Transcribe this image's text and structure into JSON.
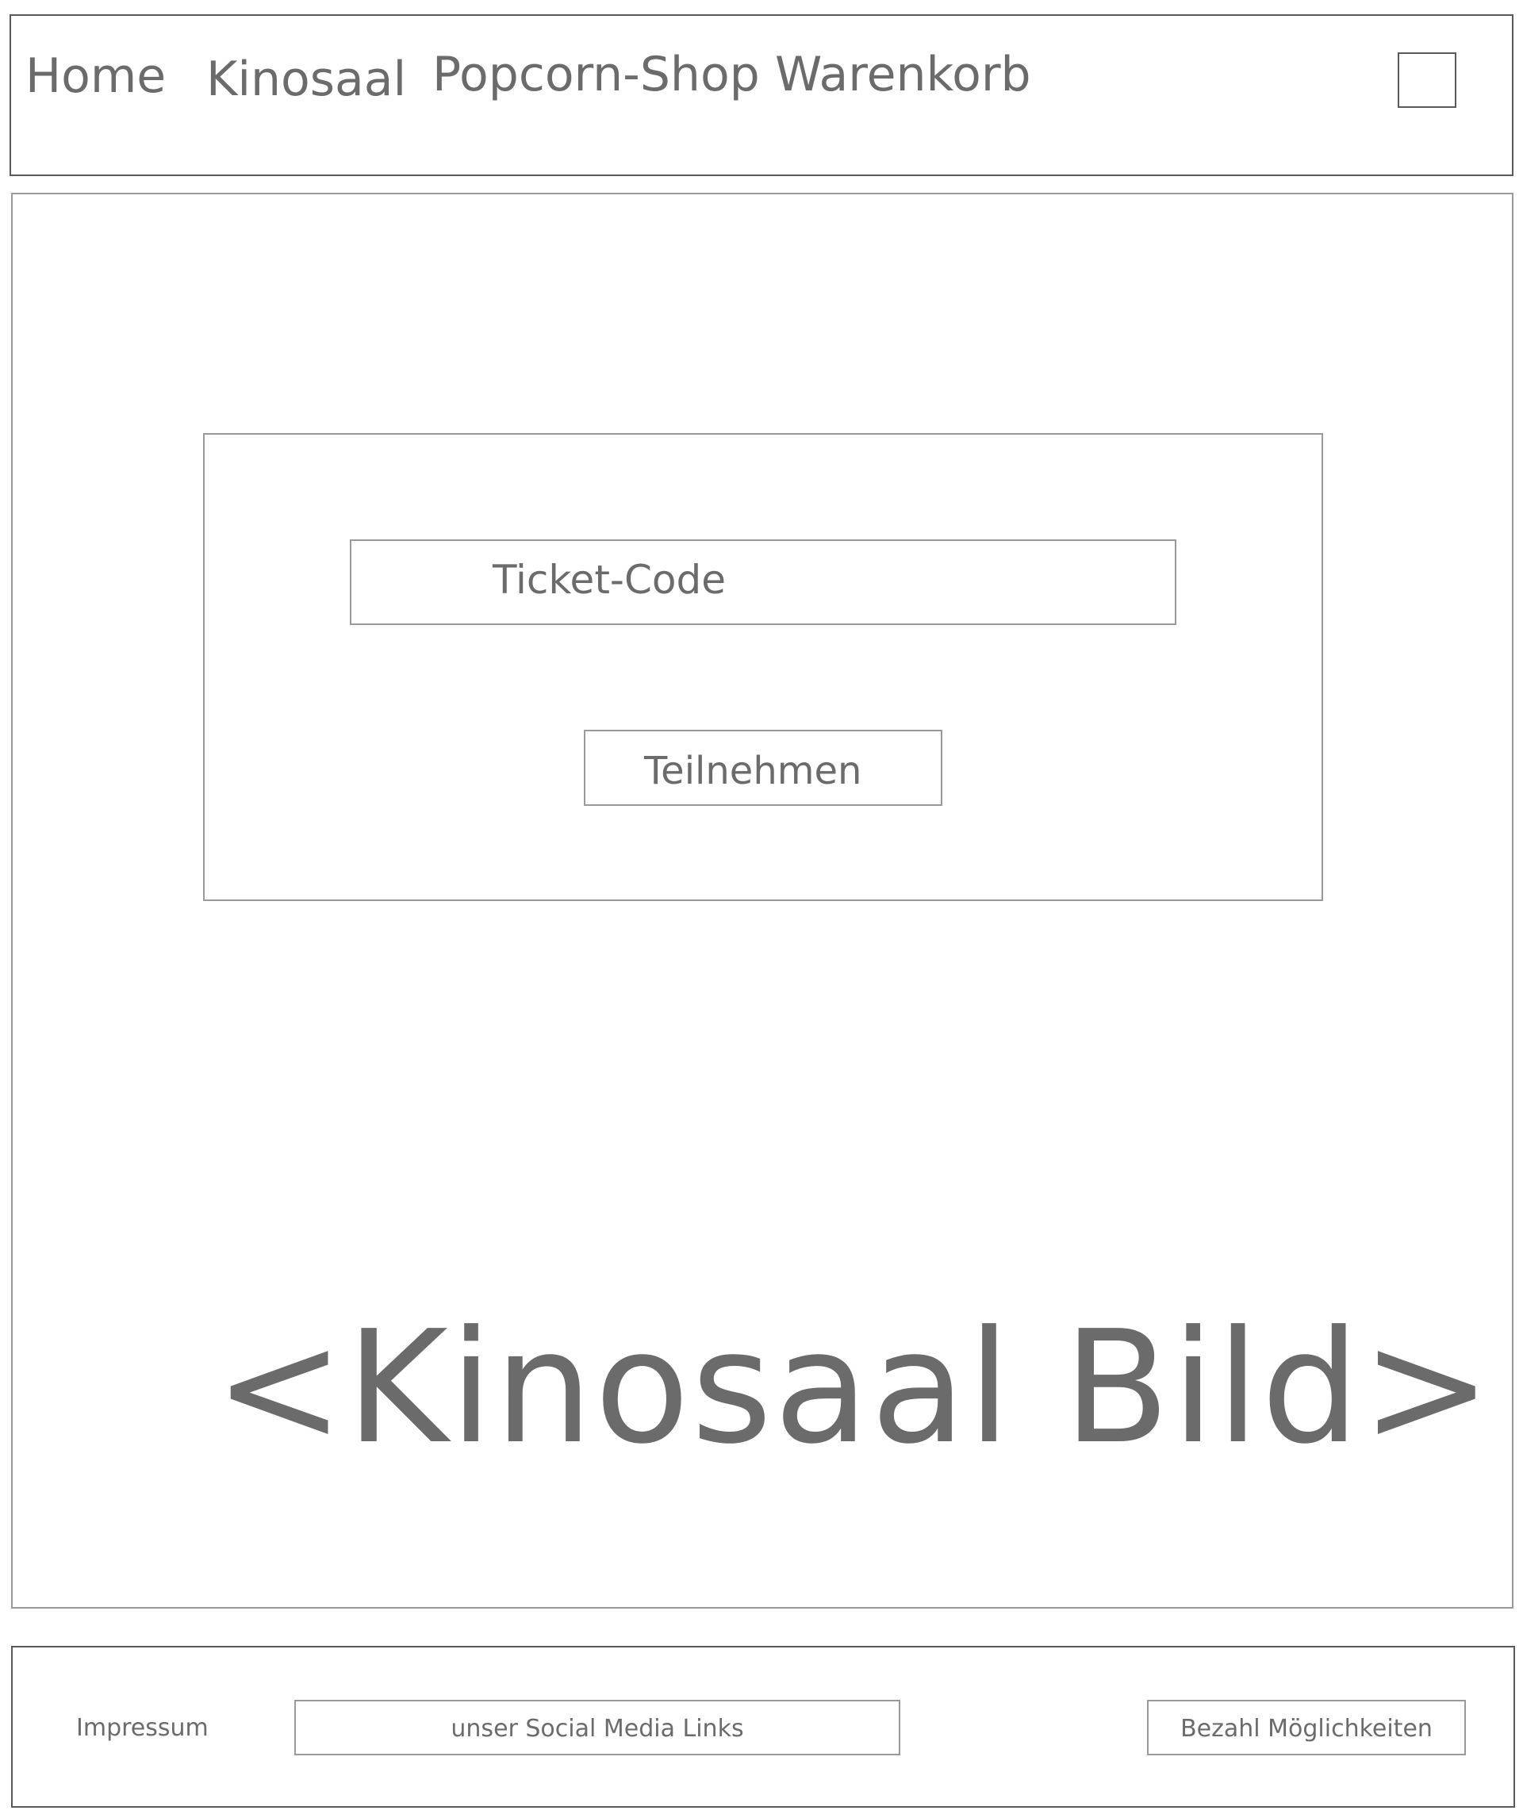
{
  "header": {
    "nav": [
      "Home",
      "Kinosaal",
      "Popcorn-Shop",
      "Warenkorb"
    ]
  },
  "main": {
    "ticket_code_placeholder": "Ticket-Code",
    "join_label": "Teilnehmen",
    "image_placeholder": "<Kinosaal Bild>"
  },
  "footer": {
    "impressum": "Impressum",
    "social_links": "unser Social Media Links",
    "payment": "Bezahl Möglichkeiten"
  }
}
